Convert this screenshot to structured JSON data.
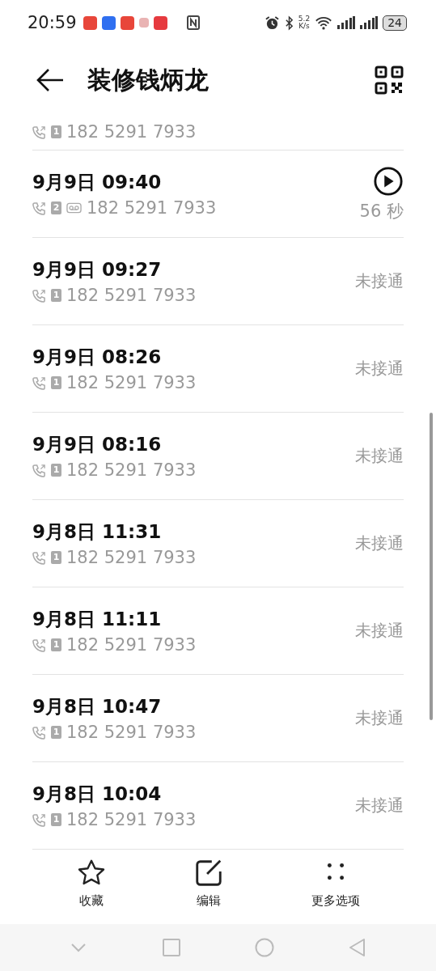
{
  "status_bar": {
    "time": "20:59",
    "speed_value": "5.2",
    "speed_unit": "K/s",
    "battery": "24"
  },
  "header": {
    "title": "装修钱炳龙"
  },
  "partial_row": {
    "sim": "1",
    "number": "182 5291 7933"
  },
  "calls": [
    {
      "date": "9月9日 09:40",
      "sim": "2",
      "voicemail": true,
      "number": "182 5291 7933",
      "kind": "recorded",
      "status": "56 秒"
    },
    {
      "date": "9月9日 09:27",
      "sim": "1",
      "voicemail": false,
      "number": "182 5291 7933",
      "kind": "missed",
      "status": "未接通"
    },
    {
      "date": "9月9日 08:26",
      "sim": "1",
      "voicemail": false,
      "number": "182 5291 7933",
      "kind": "missed",
      "status": "未接通"
    },
    {
      "date": "9月9日 08:16",
      "sim": "1",
      "voicemail": false,
      "number": "182 5291 7933",
      "kind": "missed",
      "status": "未接通"
    },
    {
      "date": "9月8日 11:31",
      "sim": "1",
      "voicemail": false,
      "number": "182 5291 7933",
      "kind": "missed",
      "status": "未接通"
    },
    {
      "date": "9月8日 11:11",
      "sim": "1",
      "voicemail": false,
      "number": "182 5291 7933",
      "kind": "missed",
      "status": "未接通"
    },
    {
      "date": "9月8日 10:47",
      "sim": "1",
      "voicemail": false,
      "number": "182 5291 7933",
      "kind": "missed",
      "status": "未接通"
    },
    {
      "date": "9月8日 10:04",
      "sim": "1",
      "voicemail": false,
      "number": "182 5291 7933",
      "kind": "missed",
      "status": "未接通"
    }
  ],
  "actions": [
    {
      "kind": "favorite",
      "label": "收藏"
    },
    {
      "kind": "edit",
      "label": "编辑"
    },
    {
      "kind": "more",
      "label": "更多选项"
    }
  ]
}
